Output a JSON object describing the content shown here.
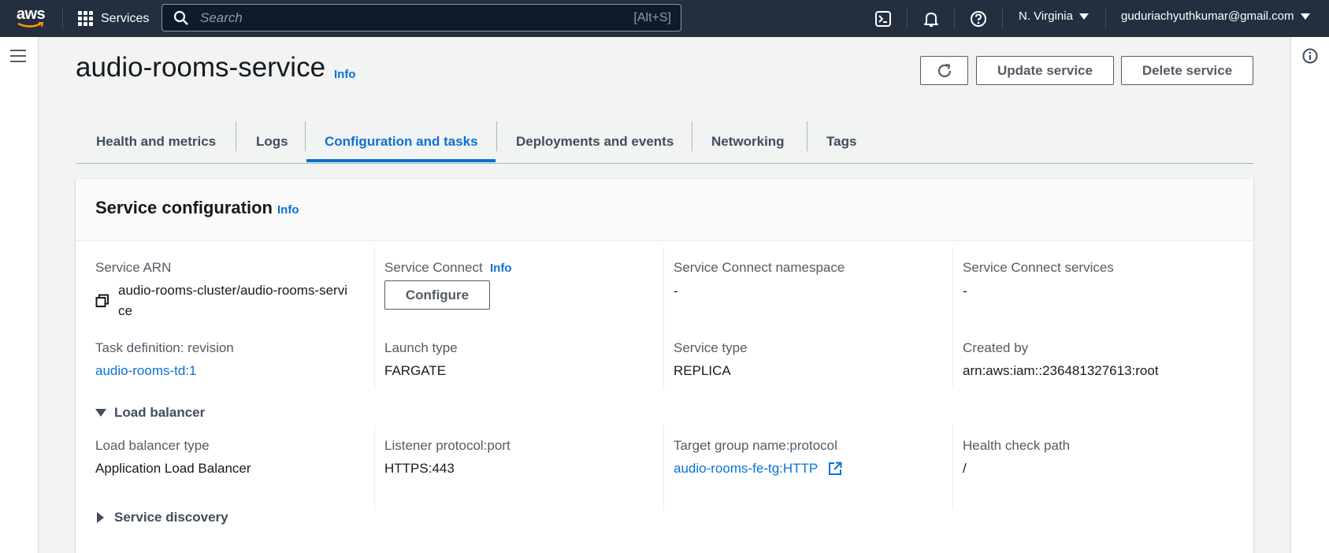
{
  "topnav": {
    "logo_text": "aws",
    "services_label": "Services",
    "search_placeholder": "Search",
    "search_shortcut": "[Alt+S]",
    "region": "N. Virginia",
    "account": "guduriachyuthkumar@gmail.com",
    "icons": [
      "cloudshell-icon",
      "bell-icon",
      "help-icon"
    ]
  },
  "header": {
    "title": "audio-rooms-service",
    "info": "Info",
    "update_button": "Update service",
    "delete_button": "Delete service"
  },
  "tabs": [
    {
      "label": "Health and metrics"
    },
    {
      "label": "Logs"
    },
    {
      "label": "Configuration and tasks",
      "active": true
    },
    {
      "label": "Deployments and events"
    },
    {
      "label": "Networking"
    },
    {
      "label": "Tags"
    }
  ],
  "panel": {
    "title": "Service configuration",
    "info": "Info",
    "service_arn": {
      "label": "Service ARN",
      "value_line1": "audio-rooms-cluster/audio-rooms-servi",
      "value_line2": "ce"
    },
    "service_connect": {
      "label": "Service Connect",
      "info": "Info",
      "button": "Configure"
    },
    "sc_namespace": {
      "label": "Service Connect namespace",
      "value": "-"
    },
    "sc_services": {
      "label": "Service Connect services",
      "value": "-"
    },
    "task_definition": {
      "label": "Task definition: revision",
      "value": "audio-rooms-td:1"
    },
    "launch_type": {
      "label": "Launch type",
      "value": "FARGATE"
    },
    "service_type": {
      "label": "Service type",
      "value": "REPLICA"
    },
    "created_by": {
      "label": "Created by",
      "value": "arn:aws:iam::236481327613:root"
    },
    "load_balancer": {
      "section_label": "Load balancer",
      "type": {
        "label": "Load balancer type",
        "value": "Application Load Balancer"
      },
      "listener": {
        "label": "Listener protocol:port",
        "value": "HTTPS:443"
      },
      "target_group": {
        "label": "Target group name:protocol",
        "value": "audio-rooms-fe-tg:HTTP"
      },
      "health_check": {
        "label": "Health check path",
        "value": "/"
      }
    },
    "service_discovery": {
      "section_label": "Service discovery"
    }
  },
  "colors": {
    "nav_bg": "#232f3e",
    "link": "#0972d3",
    "page_bg": "#f2f3f3"
  }
}
